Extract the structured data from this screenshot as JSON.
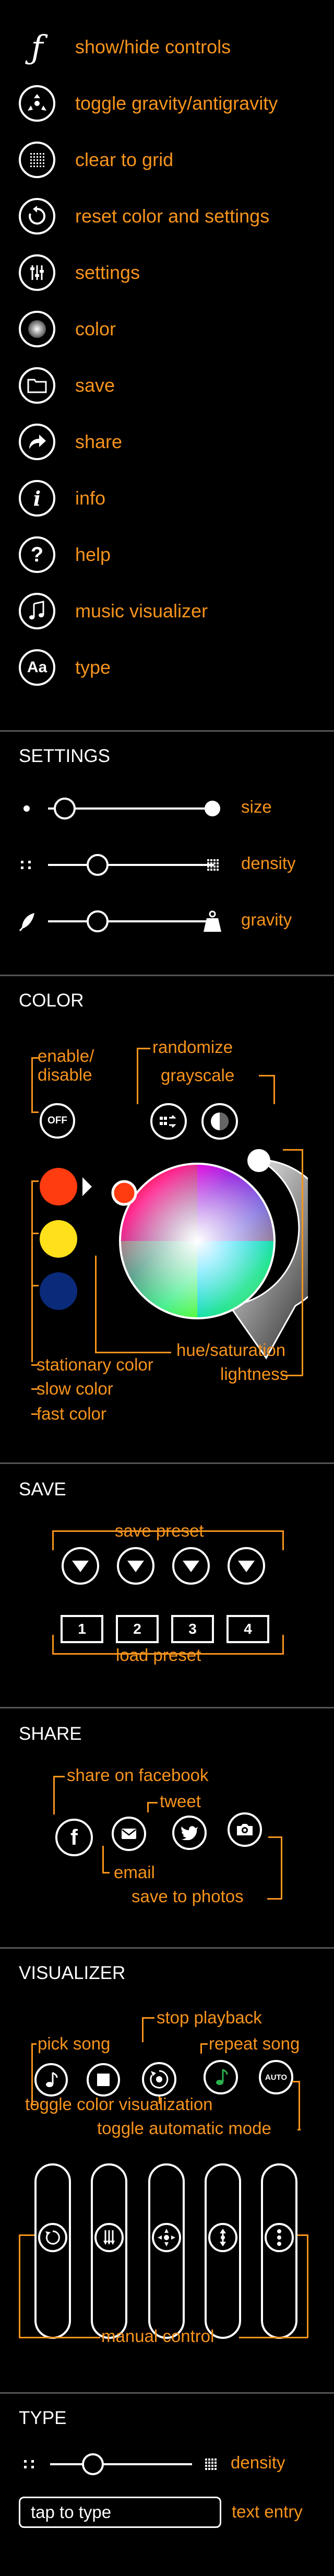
{
  "menu": {
    "items": [
      {
        "label": "show/hide controls",
        "icon": "f-icon"
      },
      {
        "label": "toggle gravity/antigravity",
        "icon": "gravity-icon"
      },
      {
        "label": "clear to grid",
        "icon": "grid-icon"
      },
      {
        "label": "reset color and settings",
        "icon": "reset-icon"
      },
      {
        "label": "settings",
        "icon": "sliders-icon"
      },
      {
        "label": "color",
        "icon": "color-icon"
      },
      {
        "label": "save",
        "icon": "folder-icon"
      },
      {
        "label": "share",
        "icon": "share-icon"
      },
      {
        "label": "info",
        "icon": "info-icon"
      },
      {
        "label": "help",
        "icon": "help-icon"
      },
      {
        "label": "music visualizer",
        "icon": "music-icon"
      },
      {
        "label": "type",
        "icon": "type-icon"
      }
    ],
    "type_icon_text": "Aa",
    "info_icon_text": "i",
    "help_icon_text": "?"
  },
  "settings": {
    "title": "SETTINGS",
    "size_label": "size",
    "density_label": "density",
    "gravity_label": "gravity",
    "size_value": 0.1,
    "density_value": 0.3,
    "gravity_value": 0.3
  },
  "color": {
    "title": "COLOR",
    "enable_disable": "enable/\ndisable",
    "off_label": "OFF",
    "randomize": "randomize",
    "grayscale": "grayscale",
    "hue_saturation": "hue/saturation",
    "lightness": "lightness",
    "stationary_color": "stationary color",
    "slow_color": "slow color",
    "fast_color": "fast color",
    "swatches": [
      "#ff3b10",
      "#ffe01a",
      "#0a2a7a"
    ]
  },
  "save": {
    "title": "SAVE",
    "save_preset": "save preset",
    "load_preset": "load preset",
    "folders": [
      "1",
      "2",
      "3",
      "4"
    ]
  },
  "share": {
    "title": "SHARE",
    "facebook": "share on facebook",
    "tweet": "tweet",
    "email": "email",
    "photos": "save to photos"
  },
  "visualizer": {
    "title": "VISUALIZER",
    "pick_song": "pick song",
    "stop_playback": "stop playback",
    "repeat_song": "repeat song",
    "auto_label": "AUTO",
    "toggle_color_vis": "toggle color visualization",
    "toggle_auto_mode": "toggle automatic mode",
    "manual_control": "manual control"
  },
  "type": {
    "title": "TYPE",
    "density_label": "density",
    "density_value": 0.3,
    "placeholder": "tap to type",
    "text_entry_label": "text entry"
  },
  "colors": {
    "accent": "#f7941d",
    "foreground": "#ffffff",
    "background": "#000000",
    "repeat_note": "#2bb24c"
  }
}
